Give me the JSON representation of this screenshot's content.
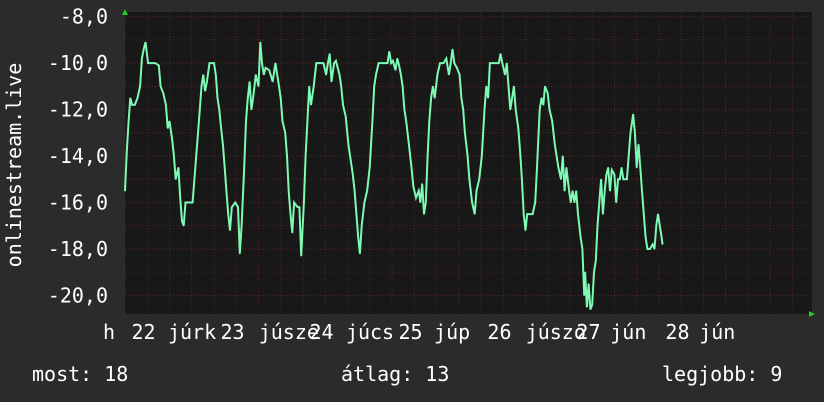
{
  "stats": {
    "now": "most: 18",
    "avg": "átlag: 13",
    "best": "legjobb: 9"
  },
  "colors": {
    "background": "#2b2b2b",
    "plot_background": "#181818",
    "grid": "#5a2323",
    "line": "#7dfab4",
    "axis_arrow": "#22cc22"
  },
  "chart_data": {
    "type": "line",
    "ylabel": "onlinestream.live",
    "ylim": [
      -20.8,
      -7.8
    ],
    "yticks": [
      -8,
      -10,
      -12,
      -14,
      -16,
      -18,
      -20
    ],
    "ytick_labels": [
      "-8,0",
      "-10,0",
      "-12,0",
      "-14,0",
      "-16,0",
      "-18,0",
      "-20,0"
    ],
    "xlim": [
      0,
      7.72
    ],
    "xticks": [
      {
        "pos": 0.0,
        "label": "h"
      },
      {
        "pos": 0.32,
        "label": "22"
      },
      {
        "pos": 0.73,
        "label": "júrk"
      },
      {
        "pos": 1.32,
        "label": "23"
      },
      {
        "pos": 1.75,
        "label": "júsze"
      },
      {
        "pos": 2.32,
        "label": "24"
      },
      {
        "pos": 2.73,
        "label": "júcs"
      },
      {
        "pos": 3.32,
        "label": "25"
      },
      {
        "pos": 3.72,
        "label": "júp"
      },
      {
        "pos": 4.32,
        "label": "26"
      },
      {
        "pos": 4.75,
        "label": "júszo"
      },
      {
        "pos": 5.32,
        "label": "27"
      },
      {
        "pos": 5.7,
        "label": "jún"
      },
      {
        "pos": 6.32,
        "label": "28"
      },
      {
        "pos": 6.7,
        "label": "jún"
      }
    ],
    "grid": true,
    "series": [
      {
        "values": [
          [
            0.0,
            -15.5
          ],
          [
            0.02,
            -13.8
          ],
          [
            0.04,
            -12.5
          ],
          [
            0.06,
            -11.5
          ],
          [
            0.08,
            -11.8
          ],
          [
            0.11,
            -11.8
          ],
          [
            0.14,
            -11.5
          ],
          [
            0.17,
            -11.0
          ],
          [
            0.19,
            -9.8
          ],
          [
            0.21,
            -9.4
          ],
          [
            0.23,
            -9.1
          ],
          [
            0.26,
            -10.0
          ],
          [
            0.3,
            -10.0
          ],
          [
            0.34,
            -10.0
          ],
          [
            0.38,
            -10.1
          ],
          [
            0.4,
            -11.0
          ],
          [
            0.43,
            -11.3
          ],
          [
            0.46,
            -11.8
          ],
          [
            0.48,
            -12.8
          ],
          [
            0.5,
            -12.5
          ],
          [
            0.53,
            -13.3
          ],
          [
            0.55,
            -14.0
          ],
          [
            0.57,
            -15.0
          ],
          [
            0.6,
            -14.5
          ],
          [
            0.62,
            -15.8
          ],
          [
            0.64,
            -16.8
          ],
          [
            0.66,
            -17.0
          ],
          [
            0.68,
            -16.0
          ],
          [
            0.72,
            -16.0
          ],
          [
            0.76,
            -16.0
          ],
          [
            0.78,
            -15.0
          ],
          [
            0.8,
            -14.0
          ],
          [
            0.82,
            -13.0
          ],
          [
            0.84,
            -12.0
          ],
          [
            0.86,
            -11.0
          ],
          [
            0.88,
            -10.5
          ],
          [
            0.9,
            -11.2
          ],
          [
            0.92,
            -10.8
          ],
          [
            0.95,
            -10.0
          ],
          [
            0.98,
            -10.0
          ],
          [
            1.0,
            -10.0
          ],
          [
            1.02,
            -10.5
          ],
          [
            1.04,
            -11.5
          ],
          [
            1.06,
            -12.0
          ],
          [
            1.08,
            -12.8
          ],
          [
            1.1,
            -13.5
          ],
          [
            1.12,
            -14.5
          ],
          [
            1.14,
            -15.5
          ],
          [
            1.16,
            -16.5
          ],
          [
            1.18,
            -17.2
          ],
          [
            1.2,
            -16.2
          ],
          [
            1.24,
            -16.0
          ],
          [
            1.27,
            -16.2
          ],
          [
            1.29,
            -18.2
          ],
          [
            1.31,
            -17.0
          ],
          [
            1.34,
            -14.5
          ],
          [
            1.36,
            -12.5
          ],
          [
            1.38,
            -11.5
          ],
          [
            1.4,
            -10.8
          ],
          [
            1.42,
            -12.0
          ],
          [
            1.44,
            -11.5
          ],
          [
            1.47,
            -10.5
          ],
          [
            1.5,
            -11.0
          ],
          [
            1.52,
            -9.1
          ],
          [
            1.54,
            -10.0
          ],
          [
            1.56,
            -10.5
          ],
          [
            1.58,
            -10.2
          ],
          [
            1.62,
            -10.3
          ],
          [
            1.66,
            -10.8
          ],
          [
            1.69,
            -10.0
          ],
          [
            1.71,
            -10.5
          ],
          [
            1.73,
            -11.0
          ],
          [
            1.75,
            -11.5
          ],
          [
            1.77,
            -12.5
          ],
          [
            1.8,
            -13.0
          ],
          [
            1.82,
            -14.0
          ],
          [
            1.84,
            -15.5
          ],
          [
            1.86,
            -16.5
          ],
          [
            1.88,
            -17.3
          ],
          [
            1.9,
            -16.0
          ],
          [
            1.94,
            -16.2
          ],
          [
            1.96,
            -16.2
          ],
          [
            1.98,
            -18.3
          ],
          [
            2.01,
            -16.0
          ],
          [
            2.03,
            -14.0
          ],
          [
            2.05,
            -12.5
          ],
          [
            2.07,
            -11.0
          ],
          [
            2.09,
            -11.8
          ],
          [
            2.12,
            -11.0
          ],
          [
            2.15,
            -10.0
          ],
          [
            2.19,
            -10.0
          ],
          [
            2.23,
            -10.0
          ],
          [
            2.26,
            -10.5
          ],
          [
            2.28,
            -10.0
          ],
          [
            2.3,
            -9.6
          ],
          [
            2.32,
            -10.8
          ],
          [
            2.35,
            -10.0
          ],
          [
            2.37,
            -9.9
          ],
          [
            2.41,
            -10.5
          ],
          [
            2.43,
            -11.0
          ],
          [
            2.45,
            -11.8
          ],
          [
            2.48,
            -12.3
          ],
          [
            2.51,
            -13.5
          ],
          [
            2.53,
            -14.0
          ],
          [
            2.56,
            -14.8
          ],
          [
            2.58,
            -15.5
          ],
          [
            2.6,
            -16.5
          ],
          [
            2.62,
            -17.5
          ],
          [
            2.64,
            -18.2
          ],
          [
            2.66,
            -17.0
          ],
          [
            2.69,
            -16.0
          ],
          [
            2.72,
            -15.5
          ],
          [
            2.75,
            -14.5
          ],
          [
            2.78,
            -12.5
          ],
          [
            2.8,
            -11.0
          ],
          [
            2.82,
            -10.5
          ],
          [
            2.85,
            -10.0
          ],
          [
            2.88,
            -10.0
          ],
          [
            2.92,
            -10.0
          ],
          [
            2.95,
            -10.0
          ],
          [
            2.97,
            -9.5
          ],
          [
            2.99,
            -10.0
          ],
          [
            3.01,
            -9.9
          ],
          [
            3.04,
            -10.3
          ],
          [
            3.06,
            -9.8
          ],
          [
            3.08,
            -10.1
          ],
          [
            3.1,
            -10.5
          ],
          [
            3.12,
            -11.0
          ],
          [
            3.14,
            -12.0
          ],
          [
            3.16,
            -12.5
          ],
          [
            3.19,
            -13.5
          ],
          [
            3.22,
            -14.5
          ],
          [
            3.24,
            -15.3
          ],
          [
            3.27,
            -15.8
          ],
          [
            3.3,
            -15.5
          ],
          [
            3.32,
            -16.0
          ],
          [
            3.34,
            -15.2
          ],
          [
            3.36,
            -16.5
          ],
          [
            3.38,
            -16.0
          ],
          [
            3.4,
            -14.0
          ],
          [
            3.42,
            -12.5
          ],
          [
            3.44,
            -11.5
          ],
          [
            3.46,
            -11.0
          ],
          [
            3.48,
            -11.5
          ],
          [
            3.51,
            -10.5
          ],
          [
            3.54,
            -10.0
          ],
          [
            3.58,
            -10.0
          ],
          [
            3.61,
            -9.8
          ],
          [
            3.64,
            -10.5
          ],
          [
            3.66,
            -10.0
          ],
          [
            3.68,
            -9.4
          ],
          [
            3.7,
            -10.0
          ],
          [
            3.73,
            -10.2
          ],
          [
            3.76,
            -10.5
          ],
          [
            3.78,
            -11.5
          ],
          [
            3.8,
            -12.0
          ],
          [
            3.82,
            -13.0
          ],
          [
            3.85,
            -14.0
          ],
          [
            3.87,
            -15.0
          ],
          [
            3.9,
            -16.0
          ],
          [
            3.93,
            -16.5
          ],
          [
            3.95,
            -15.5
          ],
          [
            3.98,
            -15.0
          ],
          [
            4.01,
            -14.0
          ],
          [
            4.04,
            -12.0
          ],
          [
            4.06,
            -11.0
          ],
          [
            4.08,
            -11.5
          ],
          [
            4.1,
            -10.0
          ],
          [
            4.13,
            -10.0
          ],
          [
            4.17,
            -10.0
          ],
          [
            4.2,
            -10.0
          ],
          [
            4.22,
            -9.6
          ],
          [
            4.24,
            -10.0
          ],
          [
            4.27,
            -10.5
          ],
          [
            4.29,
            -10.0
          ],
          [
            4.31,
            -11.0
          ],
          [
            4.33,
            -12.0
          ],
          [
            4.35,
            -11.5
          ],
          [
            4.37,
            -11.0
          ],
          [
            4.39,
            -12.0
          ],
          [
            4.42,
            -12.8
          ],
          [
            4.44,
            -13.8
          ],
          [
            4.46,
            -15.0
          ],
          [
            4.48,
            -16.5
          ],
          [
            4.5,
            -17.2
          ],
          [
            4.52,
            -16.5
          ],
          [
            4.55,
            -16.5
          ],
          [
            4.58,
            -16.5
          ],
          [
            4.61,
            -16.0
          ],
          [
            4.63,
            -14.5
          ],
          [
            4.66,
            -12.0
          ],
          [
            4.68,
            -11.5
          ],
          [
            4.7,
            -11.8
          ],
          [
            4.72,
            -11.0
          ],
          [
            4.75,
            -11.3
          ],
          [
            4.77,
            -12.0
          ],
          [
            4.8,
            -12.5
          ],
          [
            4.83,
            -13.5
          ],
          [
            4.85,
            -14.0
          ],
          [
            4.87,
            -14.5
          ],
          [
            4.9,
            -15.0
          ],
          [
            4.92,
            -14.0
          ],
          [
            4.94,
            -15.5
          ],
          [
            4.96,
            -14.5
          ],
          [
            4.99,
            -15.5
          ],
          [
            5.01,
            -16.0
          ],
          [
            5.03,
            -15.5
          ],
          [
            5.05,
            -16.0
          ],
          [
            5.07,
            -15.5
          ],
          [
            5.09,
            -16.5
          ],
          [
            5.12,
            -17.5
          ],
          [
            5.14,
            -18.0
          ],
          [
            5.16,
            -20.0
          ],
          [
            5.17,
            -19.0
          ],
          [
            5.19,
            -20.5
          ],
          [
            5.21,
            -19.5
          ],
          [
            5.23,
            -20.6
          ],
          [
            5.25,
            -20.4
          ],
          [
            5.27,
            -19.0
          ],
          [
            5.29,
            -18.5
          ],
          [
            5.31,
            -17.0
          ],
          [
            5.33,
            -16.0
          ],
          [
            5.35,
            -15.0
          ],
          [
            5.37,
            -16.5
          ],
          [
            5.39,
            -15.5
          ],
          [
            5.41,
            -14.8
          ],
          [
            5.43,
            -14.5
          ],
          [
            5.45,
            -15.5
          ],
          [
            5.47,
            -14.6
          ],
          [
            5.5,
            -14.8
          ],
          [
            5.52,
            -16.0
          ],
          [
            5.54,
            -15.0
          ],
          [
            5.56,
            -15.0
          ],
          [
            5.58,
            -14.5
          ],
          [
            5.6,
            -15.0
          ],
          [
            5.62,
            -15.0
          ],
          [
            5.64,
            -15.0
          ],
          [
            5.66,
            -14.0
          ],
          [
            5.68,
            -13.0
          ],
          [
            5.7,
            -12.5
          ],
          [
            5.71,
            -12.2
          ],
          [
            5.73,
            -13.0
          ],
          [
            5.75,
            -14.5
          ],
          [
            5.77,
            -13.5
          ],
          [
            5.79,
            -14.5
          ],
          [
            5.81,
            -15.5
          ],
          [
            5.83,
            -16.5
          ],
          [
            5.85,
            -17.5
          ],
          [
            5.87,
            -18.0
          ],
          [
            5.9,
            -18.0
          ],
          [
            5.93,
            -17.8
          ],
          [
            5.95,
            -18.0
          ],
          [
            5.97,
            -17.0
          ],
          [
            5.99,
            -16.5
          ],
          [
            6.01,
            -17.0
          ],
          [
            6.03,
            -17.5
          ],
          [
            6.04,
            -17.8
          ]
        ]
      }
    ]
  }
}
